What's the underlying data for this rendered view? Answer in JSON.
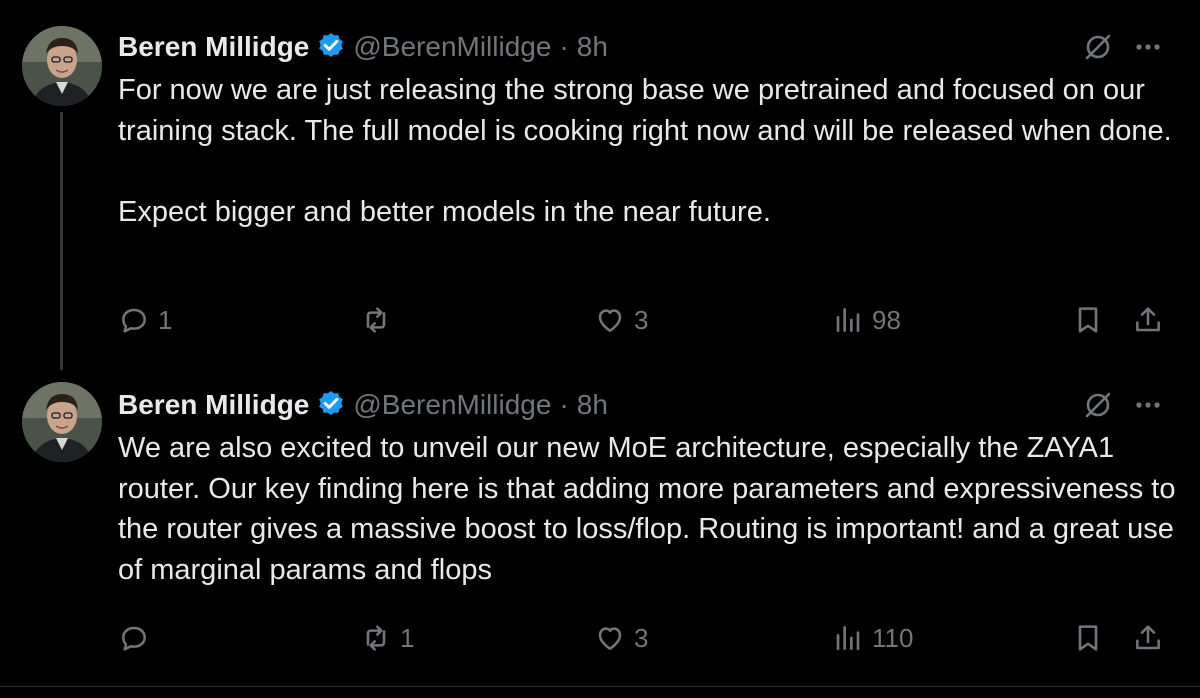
{
  "colors": {
    "background": "#000000",
    "primary_text": "#e7e9ea",
    "secondary_text": "#71767b",
    "verified_badge": "#1d9bf0",
    "thread_line": "#333639"
  },
  "icons": {
    "verified": "verified-badge-icon",
    "grok": "grok-icon",
    "more": "more-icon",
    "reply": "reply-icon",
    "repost": "repost-icon",
    "like": "heart-icon",
    "views": "views-icon",
    "bookmark": "bookmark-icon",
    "share": "share-icon"
  },
  "tweets": [
    {
      "author_name": "Beren Millidge",
      "handle": "@BerenMillidge",
      "separator": "·",
      "timestamp": "8h",
      "text": "For now we are just releasing the strong base we pretrained and focused on our training stack. The full model is cooking right now and will be released when done.\n\nExpect bigger and better models in the near future.",
      "stats": {
        "replies": "1",
        "reposts": "",
        "likes": "3",
        "views": "98"
      }
    },
    {
      "author_name": "Beren Millidge",
      "handle": "@BerenMillidge",
      "separator": "·",
      "timestamp": "8h",
      "text": "We are also excited to unveil our new MoE architecture, especially the ZAYA1 router. Our key finding here is that adding more parameters and expressiveness to the router gives a massive boost to loss/flop. Routing is important! and a great use of marginal params and flops",
      "stats": {
        "replies": "",
        "reposts": "1",
        "likes": "3",
        "views": "110"
      }
    }
  ]
}
